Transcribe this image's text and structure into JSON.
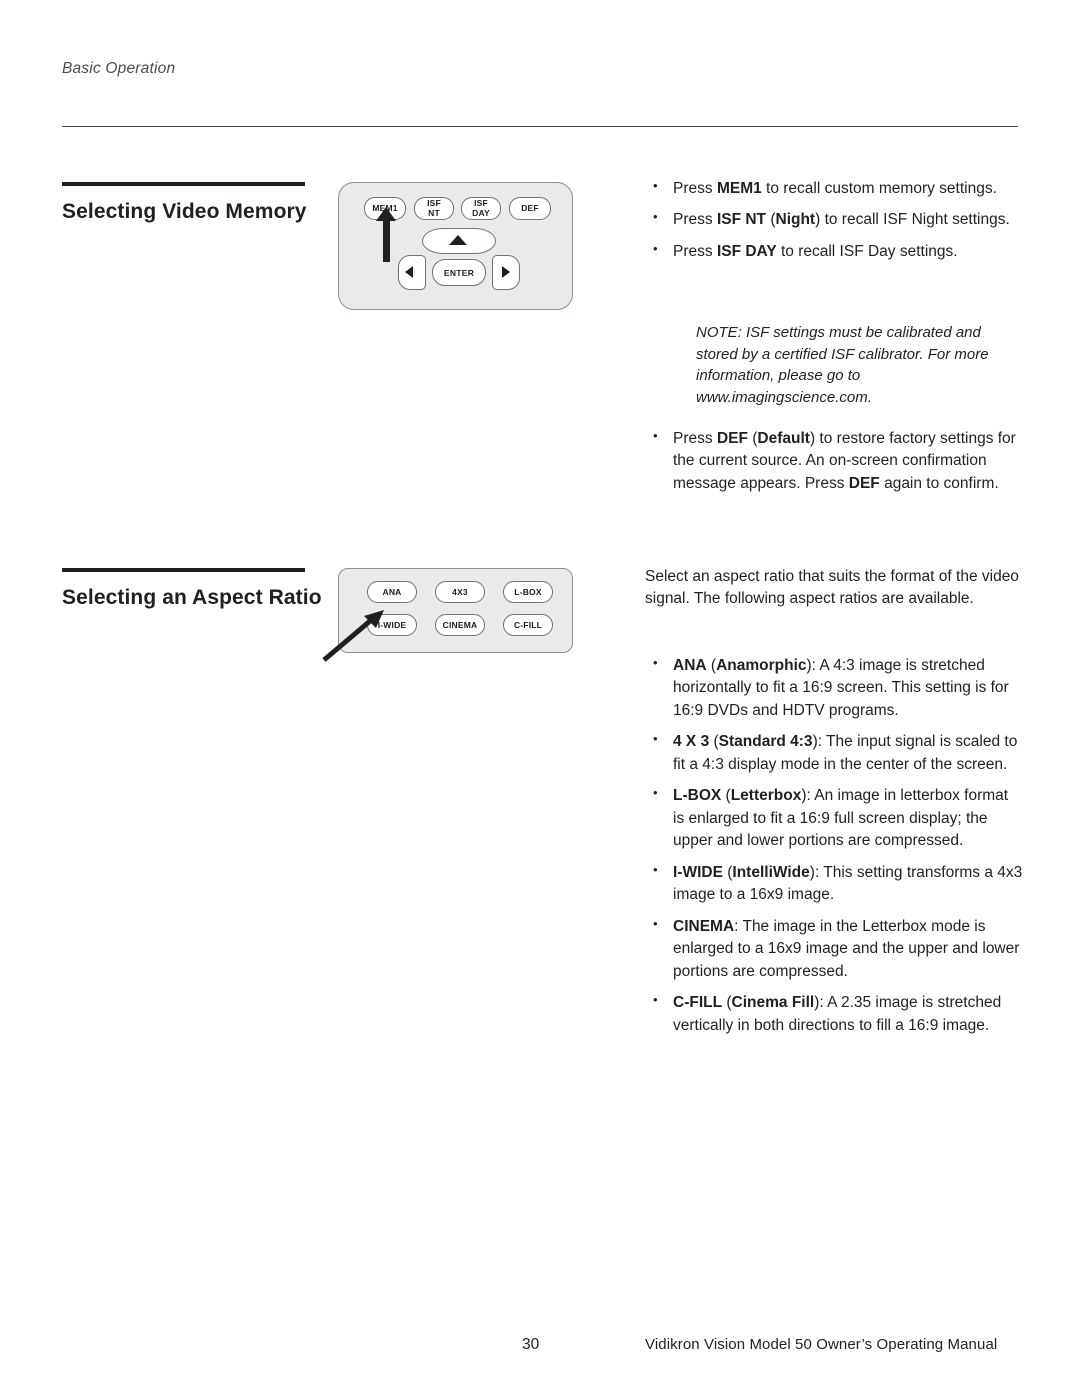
{
  "header": {
    "running_head": "Basic Operation"
  },
  "sections": [
    {
      "id": "video-memory",
      "title": "Selecting Video Memory"
    },
    {
      "id": "aspect-ratio",
      "title": "Selecting an Aspect Ratio"
    }
  ],
  "remote_memory": {
    "buttons": {
      "mem1": "MEM1",
      "isf_nt_line1": "ISF",
      "isf_nt_line2": "NT",
      "isf_day_line1": "ISF",
      "isf_day_line2": "DAY",
      "def": "DEF",
      "enter": "ENTER"
    }
  },
  "remote_aspect": {
    "buttons": {
      "ana": "ANA",
      "four_by_three": "4X3",
      "lbox": "L-BOX",
      "iwide": "I-WIDE",
      "cinema": "CINEMA",
      "cfill": "C-FILL"
    }
  },
  "memory_bullets": [
    {
      "html": "Press <b>MEM1</b> to recall custom memory settings."
    },
    {
      "html": "Press <b>ISF NT</b> (<b>Night</b>) to recall ISF Night settings."
    },
    {
      "html": "Press <b>ISF DAY</b> to recall ISF Day settings."
    }
  ],
  "memory_note": "NOTE: ISF settings must be calibrated and stored by a certified ISF calibrator. For more information, please go to www.imagingscience.com.",
  "memory_bullets_after_note": [
    {
      "html": "Press <b>DEF</b> (<b>Default</b>) to restore factory settings for the current source. An on-screen confirmation message appears. Press <b>DEF</b> again to confirm."
    }
  ],
  "aspect_intro": "Select an aspect ratio that suits the format of the video signal. The following aspect ratios are available.",
  "aspect_bullets": [
    {
      "html": "<b>ANA</b> (<b>Anamorphic</b>): A 4:3 image is stretched horizontally to fit a 16:9 screen. This setting is for 16:9 DVDs and HDTV programs."
    },
    {
      "html": "<b>4 X 3</b> (<b>Standard 4:3</b>): The input signal is scaled to fit a 4:3 display mode in the center of the screen."
    },
    {
      "html": "<b>L-BOX</b> (<b>Letterbox</b>): An image in letterbox format is enlarged to fit a 16:9 full screen display; the upper and lower portions are compressed."
    },
    {
      "html": "<b>I-WIDE</b> (<b>IntelliWide</b>): This setting transforms a 4x3 image to a 16x9 image."
    },
    {
      "html": "<b>CINEMA</b>: The image in the Letterbox mode is enlarged to a 16x9 image and the upper and lower portions are compressed."
    },
    {
      "html": "<b>C-FILL</b> (<b>Cinema Fill</b>): A 2.35 image is stretched vertically in both directions to fill a 16:9 image."
    }
  ],
  "footer": {
    "page_number": "30",
    "manual_title": "Vidikron Vision Model 50 Owner’s Operating Manual"
  }
}
